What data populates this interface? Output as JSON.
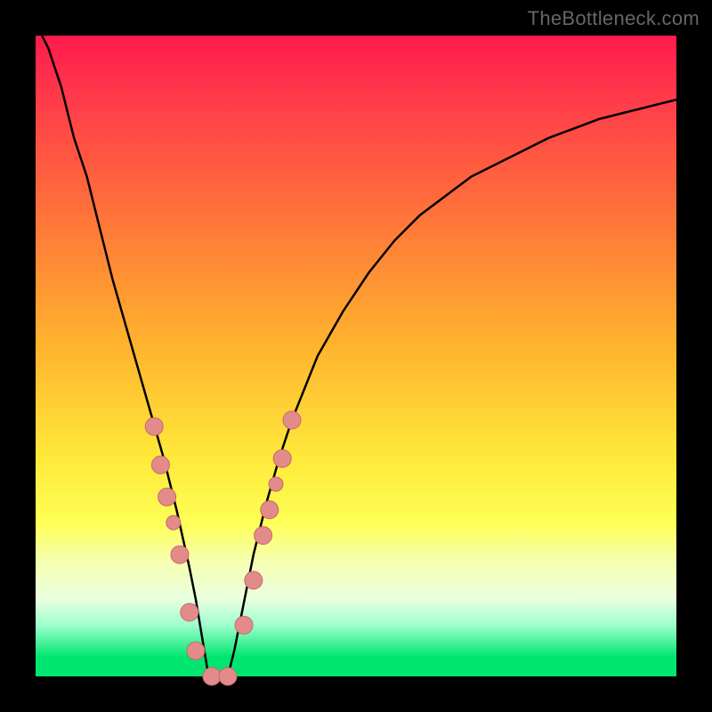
{
  "watermark": "TheBottleneck.com",
  "chart_data": {
    "type": "line",
    "title": "",
    "xlabel": "",
    "ylabel": "",
    "xlim": [
      0,
      100
    ],
    "ylim": [
      0,
      100
    ],
    "grid": false,
    "legend": false,
    "colors": {
      "curve": "#000000",
      "marker_fill": "#e38b8b",
      "marker_stroke": "#c66a6a",
      "background_top": "#ff1a4d",
      "background_bottom": "#00e56f"
    },
    "series": [
      {
        "name": "bottleneck-curve",
        "x": [
          1,
          2,
          3,
          4,
          5,
          6,
          8,
          10,
          12,
          14,
          16,
          18,
          20,
          22,
          24,
          25,
          26,
          27,
          28,
          29,
          30,
          31,
          32,
          33,
          34,
          36,
          38,
          40,
          44,
          48,
          52,
          56,
          60,
          64,
          68,
          72,
          76,
          80,
          84,
          88,
          92,
          96,
          100
        ],
        "y": [
          100,
          98,
          95,
          92,
          88,
          84,
          78,
          70,
          62,
          55,
          48,
          41,
          34,
          26,
          17,
          12,
          6,
          0,
          0,
          0,
          0,
          4,
          9,
          14,
          19,
          27,
          34,
          40,
          50,
          57,
          63,
          68,
          72,
          75,
          78,
          80,
          82,
          84,
          85.5,
          87,
          88,
          89,
          90
        ]
      }
    ],
    "markers": {
      "name": "data-points",
      "points": [
        {
          "x": 18.5,
          "y": 39,
          "r": 10
        },
        {
          "x": 19.5,
          "y": 33,
          "r": 10
        },
        {
          "x": 20.5,
          "y": 28,
          "r": 10
        },
        {
          "x": 21.5,
          "y": 24,
          "r": 8
        },
        {
          "x": 22.5,
          "y": 19,
          "r": 10
        },
        {
          "x": 24.0,
          "y": 10,
          "r": 10
        },
        {
          "x": 25.0,
          "y": 4,
          "r": 10
        },
        {
          "x": 27.5,
          "y": 0,
          "r": 10
        },
        {
          "x": 30.0,
          "y": 0,
          "r": 10
        },
        {
          "x": 32.5,
          "y": 8,
          "r": 10
        },
        {
          "x": 34.0,
          "y": 15,
          "r": 10
        },
        {
          "x": 35.5,
          "y": 22,
          "r": 10
        },
        {
          "x": 36.5,
          "y": 26,
          "r": 10
        },
        {
          "x": 37.5,
          "y": 30,
          "r": 8
        },
        {
          "x": 38.5,
          "y": 34,
          "r": 10
        },
        {
          "x": 40.0,
          "y": 40,
          "r": 10
        }
      ]
    }
  }
}
